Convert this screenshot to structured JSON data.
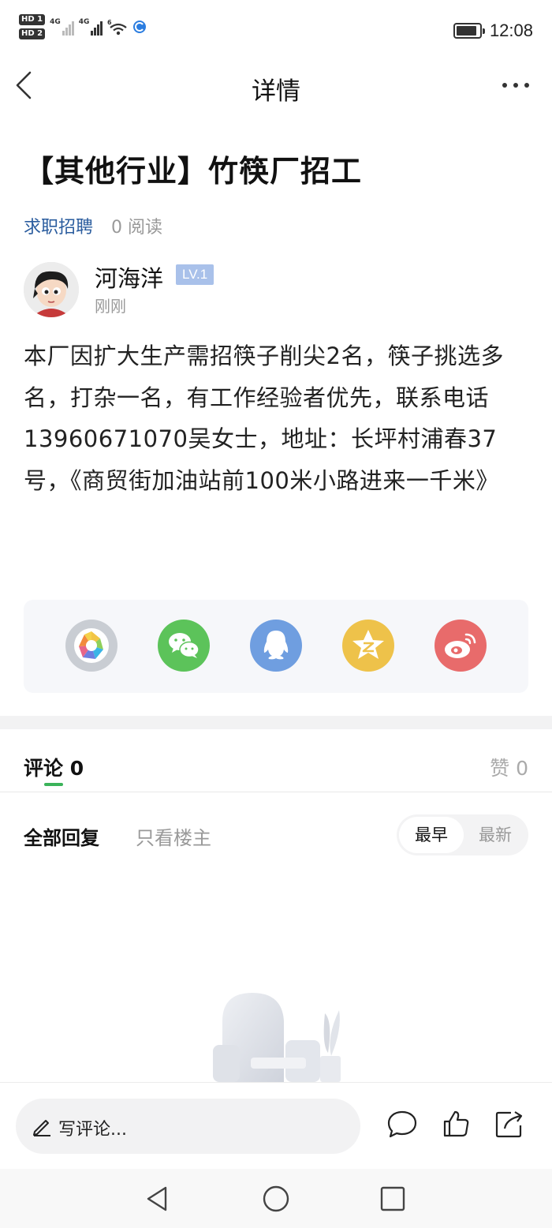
{
  "status_bar": {
    "sim1": "HD 1",
    "sim2": "HD 2",
    "net1": "4G",
    "net2": "4G",
    "wifi_badge": "6",
    "time": "12:08",
    "battery_level": 0.9
  },
  "nav": {
    "title": "详情"
  },
  "post": {
    "title": "【其他行业】竹筷厂招工",
    "category": "求职招聘",
    "reads": "0 阅读",
    "author": {
      "name": "河海洋",
      "level": "LV.1",
      "time": "刚刚"
    },
    "body": "本厂因扩大生产需招筷子削尖2名，筷子挑选多名，打杂一名，有工作经验者优先，联系电话13960671070吴女士，地址：长坪村浦春37号，《商贸街加油站前100米小路进来一千米》"
  },
  "share": {
    "items": [
      {
        "icon": "moments-icon",
        "color": "#c9cdd3"
      },
      {
        "icon": "wechat-icon",
        "color": "#5cc35a"
      },
      {
        "icon": "qq-icon",
        "color": "#6f9ee0"
      },
      {
        "icon": "qzone-icon",
        "color": "#eec24a"
      },
      {
        "icon": "weibo-icon",
        "color": "#e86b6b"
      }
    ]
  },
  "comments": {
    "tab_label": "评论",
    "count": "0",
    "like_label": "赞",
    "like_count": "0",
    "filter_all": "全部回复",
    "filter_owner": "只看楼主",
    "sort_early": "最早",
    "sort_new": "最新"
  },
  "bottom_bar": {
    "placeholder": "写评论..."
  },
  "colors": {
    "accent_green": "#3bb35a",
    "category_blue": "#2a5c9e",
    "level_badge": "#a9c1ea"
  }
}
